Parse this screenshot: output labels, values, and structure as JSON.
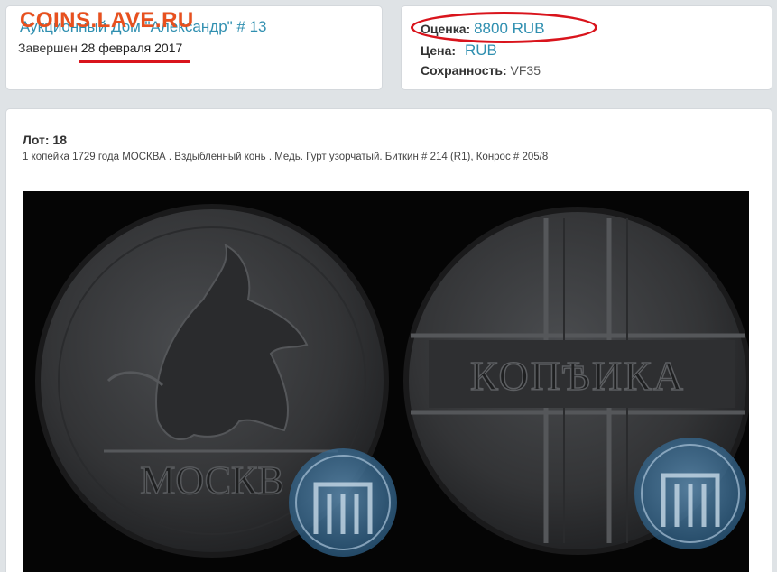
{
  "watermark": "COINS.LAVE.RU",
  "auction": {
    "title": "Аукционный Дом \"Александр\" # 13",
    "ended_prefix": "Завершен",
    "ended_date": "28 февраля 2017"
  },
  "prices": {
    "estimate_label": "Оценка:",
    "estimate_value": "8800 RUB",
    "price_label": "Цена:",
    "price_value": "RUB",
    "condition_label": "Сохранность:",
    "condition_value": "VF35"
  },
  "lot": {
    "label": "Лот: 18",
    "description": "1 копейка 1729 года МОСКВА . Вздыбленный конь . Медь. Гурт узорчатый. Биткин # 214 (R1), Конрос # 205/8"
  },
  "coin": {
    "obverse_legend": "МОСКВ",
    "reverse_legend": "КОПѢИКА"
  },
  "colors": {
    "link": "#2f8fb0",
    "highlight": "#d9141c",
    "watermark": "#e8501e",
    "coin": "#3a3b3d"
  }
}
